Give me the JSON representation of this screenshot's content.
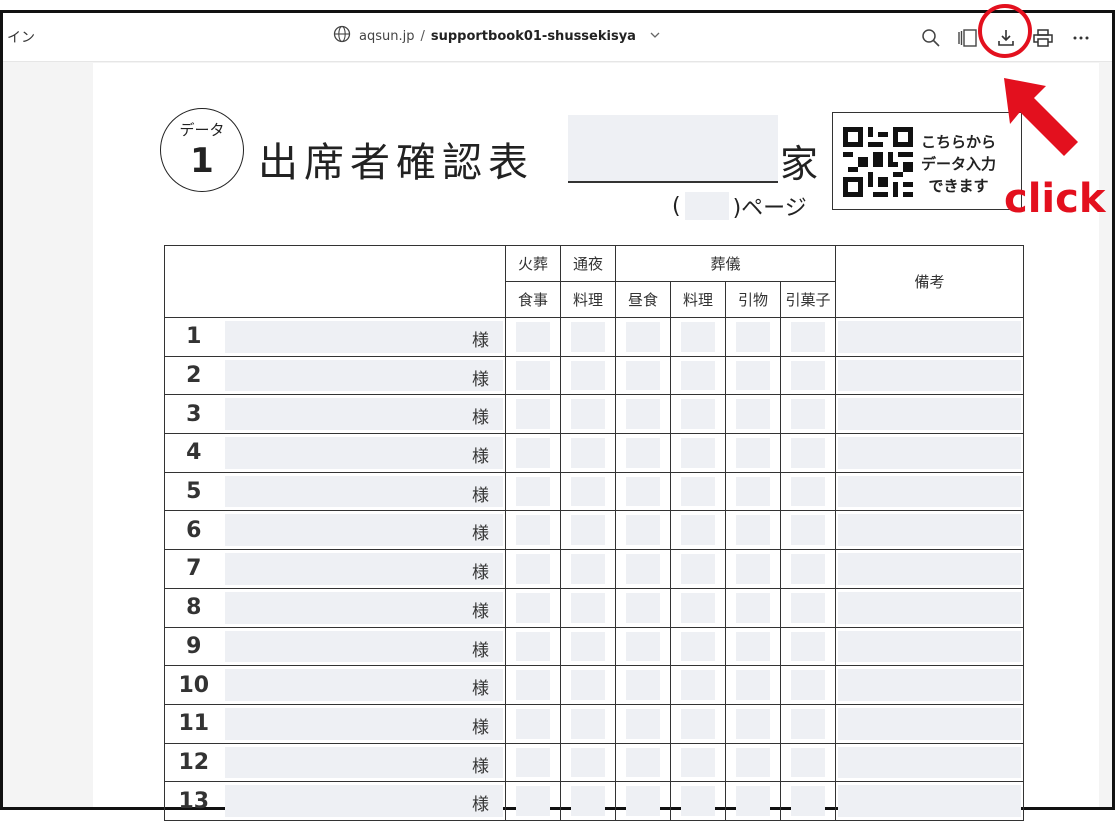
{
  "toolbar": {
    "left_text": "イン",
    "domain": "aqsun.jp",
    "separator": "/",
    "filename": "supportbook01-shussekisya",
    "icons": [
      "globe-icon",
      "chevron-down-icon",
      "search-icon",
      "page-view-icon",
      "download-icon",
      "print-icon",
      "more-icon"
    ]
  },
  "document": {
    "badge_label": "データ",
    "badge_number": "1",
    "title": "出席者確認表",
    "family_suffix": "家",
    "page_open": "(",
    "page_close": ")ページ",
    "qr_text": [
      "こちらから",
      "データ入力",
      "できます"
    ]
  },
  "table": {
    "header_top": {
      "col1": "火葬",
      "col2": "通夜",
      "group": "葬儀",
      "note": "備考"
    },
    "header_sub": [
      "食事",
      "料理",
      "昼食",
      "料理",
      "引物",
      "引菓子"
    ],
    "suffix": "様",
    "rows": [
      "1",
      "2",
      "3",
      "4",
      "5",
      "6",
      "7",
      "8",
      "9",
      "10",
      "11",
      "12",
      "13"
    ]
  },
  "annotation": {
    "label": "click",
    "color": "#e3101e"
  }
}
